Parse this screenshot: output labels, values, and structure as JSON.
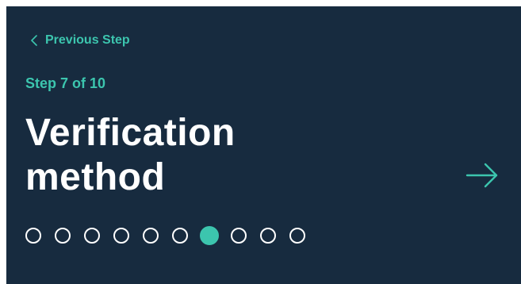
{
  "nav": {
    "previous_label": "Previous Step"
  },
  "step": {
    "counter": "Step 7 of 10",
    "current": 7,
    "total": 10
  },
  "title": {
    "line1": "Verification",
    "line2": "method"
  },
  "colors": {
    "background": "#172b3f",
    "accent": "#3cc5ae",
    "text": "#ffffff"
  },
  "icons": {
    "previous": "chevron-left-icon",
    "next": "arrow-right-icon"
  }
}
